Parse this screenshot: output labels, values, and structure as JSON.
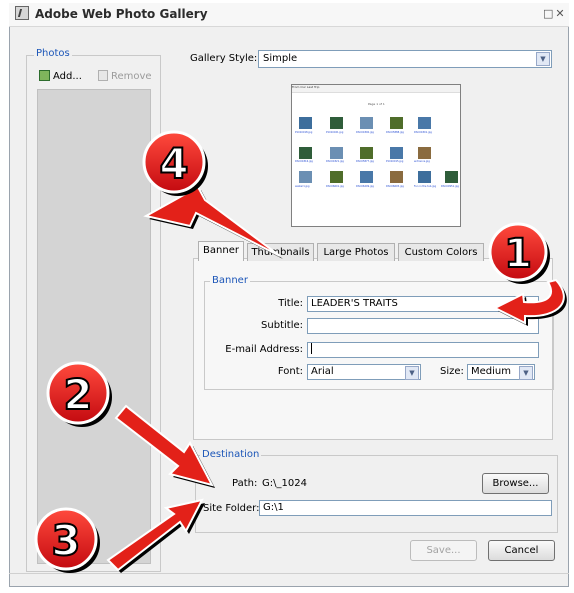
{
  "window": {
    "title": "Adobe Web Photo Gallery",
    "controls": "□✕"
  },
  "photos": {
    "legend": "Photos",
    "add_label": "Add...",
    "remove_label": "Remove"
  },
  "gallery_style": {
    "label": "Gallery Style:",
    "value": "Simple"
  },
  "preview": {
    "header": "From Our Last Trip",
    "page_text": "Page 1 of 1",
    "captions": [
      [
        "P1010018.jpg",
        "P1010021.jpg",
        "DSC01800.jpg",
        "DSC05888.jpg",
        "DSC01801.jpg"
      ],
      [
        "DSC01816.jpg",
        "DSC01821.jpg",
        "DSC05877.jpg",
        "P1010015.jpg",
        "entrance.jpg"
      ],
      [
        "walker1.jpg",
        "DSC06601.jpg",
        "DSC06299.jpg",
        "DSC06605.jpg",
        "Fun in the tub.jpg",
        "DSC00951.jpg"
      ]
    ]
  },
  "tabs": [
    {
      "label": "Banner",
      "active": true
    },
    {
      "label": "Thumbnails",
      "active": false
    },
    {
      "label": "Large Photos",
      "active": false
    },
    {
      "label": "Custom Colors",
      "active": false
    }
  ],
  "banner": {
    "legend": "Banner",
    "title_label": "Title:",
    "title_value": "LEADER'S TRAITS",
    "subtitle_label": "Subtitle:",
    "subtitle_value": "",
    "email_label": "E-mail Address:",
    "email_value": "",
    "font_label": "Font:",
    "font_value": "Arial",
    "size_label": "Size:",
    "size_value": "Medium"
  },
  "destination": {
    "legend": "Destination",
    "path_label": "Path:",
    "path_value": "G:\\_1024",
    "browse_label": "Browse...",
    "site_folder_label": "Site Folder:",
    "site_folder_value": "G:\\1"
  },
  "footer": {
    "save_label": "Save...",
    "cancel_label": "Cancel"
  },
  "callouts": {
    "one": "1",
    "two": "2",
    "three": "3",
    "four": "4"
  },
  "colors": {
    "accent_blue": "#1c56b8",
    "callout_red": "#e0121b",
    "arrow_red": "#e32119"
  }
}
